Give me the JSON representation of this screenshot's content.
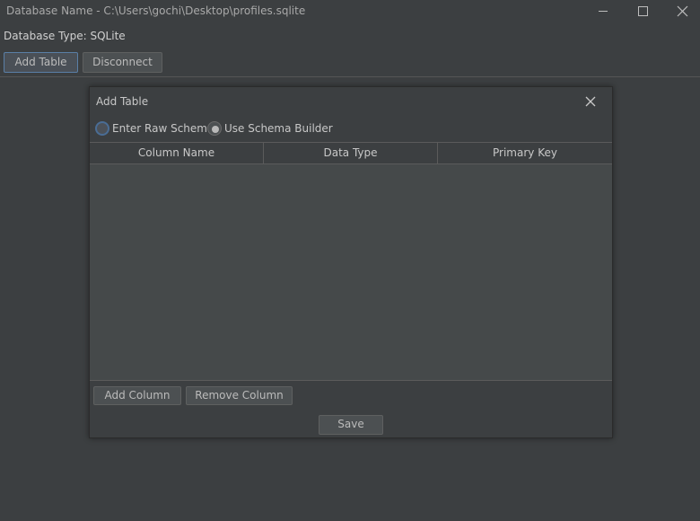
{
  "window": {
    "title": "Database Name - C:\\Users\\gochi\\Desktop\\profiles.sqlite",
    "controls": {
      "minimize_icon": "minimize-icon",
      "maximize_icon": "maximize-icon",
      "close_icon": "close-icon"
    }
  },
  "info": {
    "database_type": "Database Type: SQLite"
  },
  "toolbar": {
    "add_table_label": "Add Table",
    "disconnect_label": "Disconnect"
  },
  "dialog": {
    "title": "Add Table",
    "close_icon": "close-icon",
    "schema_mode": {
      "options": [
        {
          "label": "Enter Raw Schema",
          "selected": false
        },
        {
          "label": "Use Schema Builder",
          "selected": true
        }
      ]
    },
    "table": {
      "columns": [
        "Column Name",
        "Data Type",
        "Primary Key"
      ],
      "rows": []
    },
    "buttons": {
      "add_column_label": "Add Column",
      "remove_column_label": "Remove Column",
      "save_label": "Save"
    }
  },
  "colors": {
    "background": "#3c3f41",
    "table_body": "#45494a",
    "button": "#4c5052",
    "focus_border": "#5a7fa6",
    "text": "#bbbbbb"
  }
}
